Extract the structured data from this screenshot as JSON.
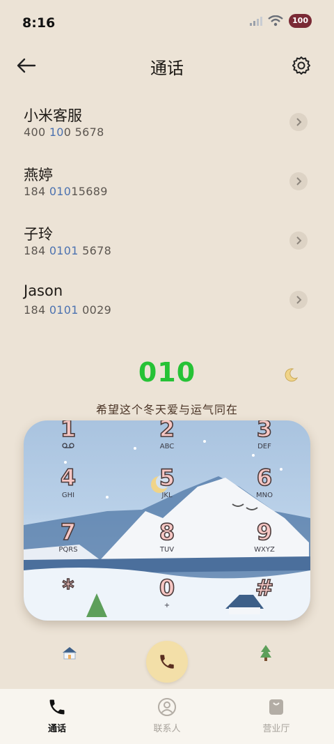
{
  "status": {
    "time": "8:16",
    "battery": "100"
  },
  "header": {
    "title": "通话"
  },
  "contacts": [
    {
      "name": "小米客服",
      "num_a": "400 ",
      "num_hl": "10",
      "num_b": "0 5678"
    },
    {
      "name": "燕婷",
      "num_a": "184 ",
      "num_hl": "010",
      "num_b": "15689"
    },
    {
      "name": "子玲",
      "num_a": "184 ",
      "num_hl": "0101",
      "num_b": " 5678"
    },
    {
      "name": "Jason",
      "num_a": "184 ",
      "num_hl": "0101",
      "num_b": " 0029"
    }
  ],
  "dialer": {
    "number": "010",
    "slogan": "希望这个冬天爱与运气同在",
    "keys": [
      {
        "digit": "1",
        "letters": ""
      },
      {
        "digit": "2",
        "letters": "ABC"
      },
      {
        "digit": "3",
        "letters": "DEF"
      },
      {
        "digit": "4",
        "letters": "GHI"
      },
      {
        "digit": "5",
        "letters": "JKL"
      },
      {
        "digit": "6",
        "letters": "MNO"
      },
      {
        "digit": "7",
        "letters": "PQRS"
      },
      {
        "digit": "8",
        "letters": "TUV"
      },
      {
        "digit": "9",
        "letters": "WXYZ"
      },
      {
        "digit": "*",
        "letters": ""
      },
      {
        "digit": "0",
        "letters": "+"
      },
      {
        "digit": "#",
        "letters": ""
      }
    ]
  },
  "nav": {
    "items": [
      {
        "label": "通话",
        "icon": "phone-icon",
        "active": true
      },
      {
        "label": "联系人",
        "icon": "person-icon",
        "active": false
      },
      {
        "label": "营业厅",
        "icon": "shopping-bag-icon",
        "active": false
      }
    ]
  },
  "colors": {
    "dialed_number": "#26c236",
    "highlight": "#4c72b0",
    "call_button": "#f3dfa8"
  }
}
